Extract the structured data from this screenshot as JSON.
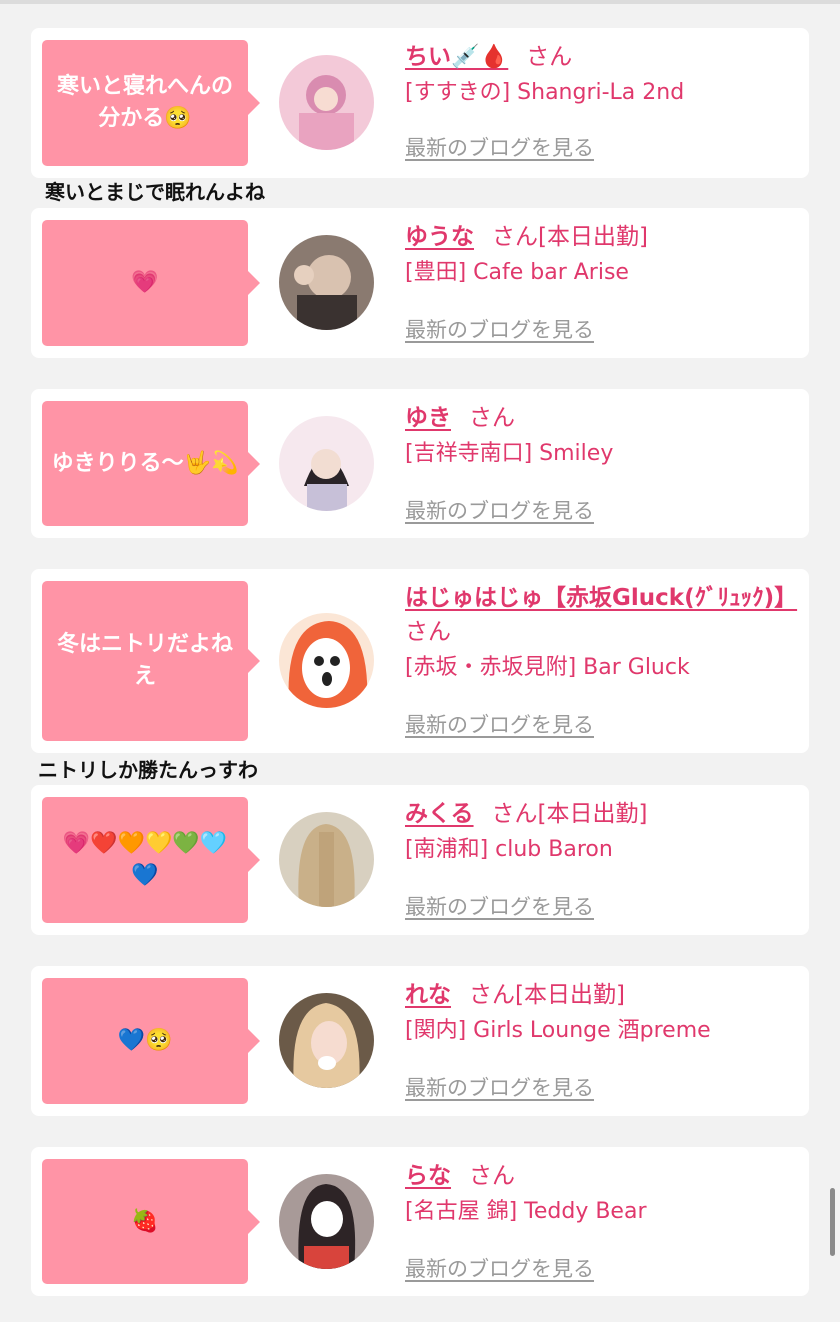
{
  "blog_link_label": "最新のブログを見る",
  "notes": [
    "寒いとまじで眠れんよね",
    "ニトリしか勝たんっすわ"
  ],
  "cards": [
    {
      "bubble": "寒いと寝れへんの分かる🥺",
      "name": "ちい💉🩸",
      "honorific": "さん",
      "status": "",
      "shop": "[すすきの] Shangri-La 2nd"
    },
    {
      "bubble": "💗",
      "name": "ゆうな",
      "honorific": "さん",
      "status": "[本日出勤]",
      "shop": "[豊田] Cafe bar Arise"
    },
    {
      "bubble": "ゆきりりる〜🤟💫",
      "name": "ゆき",
      "honorific": "さん",
      "status": "",
      "shop": "[吉祥寺南口] Smiley"
    },
    {
      "bubble": "冬はニトリだよねえ",
      "name": "はじゅはじゅ【赤坂Gluck(ｸﾞﾘｭｯｸ)】",
      "honorific": "さん",
      "status": "",
      "shop": "[赤坂・赤坂見附] Bar Gluck"
    },
    {
      "bubble": "💗❤️🧡💛💚🩵💙",
      "name": "みくる",
      "honorific": "さん",
      "status": "[本日出勤]",
      "shop": "[南浦和] club Baron"
    },
    {
      "bubble": "💙🥺",
      "name": "れな",
      "honorific": "さん",
      "status": "[本日出勤]",
      "shop": "[関内] Girls Lounge 酒preme"
    },
    {
      "bubble": "🍓",
      "name": "らな",
      "honorific": "さん",
      "status": "",
      "shop": "[名古屋 錦] Teddy Bear"
    }
  ]
}
